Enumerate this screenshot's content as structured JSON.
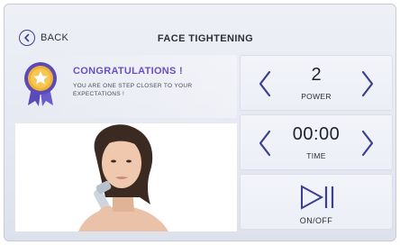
{
  "header": {
    "back_label": "BACK",
    "title": "FACE TIGHTENING"
  },
  "congrats": {
    "title": "CONGRATULATIONS !",
    "message": "YOU ARE ONE STEP CLOSER TO YOUR EXPECTATIONS !",
    "icon": "award-medal-icon"
  },
  "power": {
    "value": "2",
    "label": "POWER"
  },
  "time": {
    "value": "00:00",
    "label": "TIME"
  },
  "toggle": {
    "label": "ON/OFF",
    "icon": "play-pause-icon"
  },
  "colors": {
    "accent": "#3a3f8f",
    "congrats_title": "#6a4fc4",
    "medal_gold": "#f2b233",
    "medal_ribbon": "#5b4bb8"
  }
}
